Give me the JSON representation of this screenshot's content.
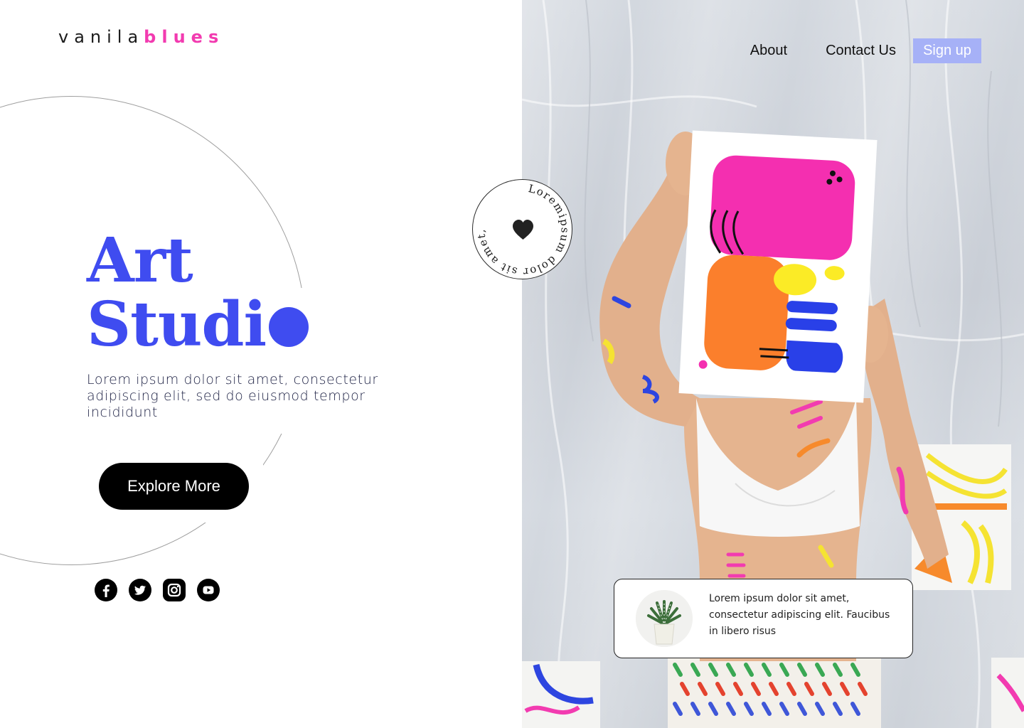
{
  "brand": {
    "logo_main": "vanila",
    "logo_accent": "blues",
    "accent_color": "#f23bb0"
  },
  "nav": {
    "about": "About",
    "contact": "Contact Us",
    "signup": "Sign up"
  },
  "hero": {
    "title_line1": "Art",
    "title_line2": "Studi",
    "description": "Lorem ipsum dolor sit amet, consectetur adipiscing elit, sed do eiusmod tempor incididunt",
    "cta": "Explore More",
    "title_color": "#3f4cf0"
  },
  "badge": {
    "circle_text": "Loremipsum dolor sit amet, cons",
    "icon": "heart-icon"
  },
  "socials": [
    {
      "name": "facebook-icon"
    },
    {
      "name": "twitter-icon"
    },
    {
      "name": "instagram-icon"
    },
    {
      "name": "youtube-icon"
    }
  ],
  "card": {
    "text": "Lorem ipsum dolor sit amet, consectetur adipiscing elit. Faucibus in libero risus",
    "thumb_icon": "plant-icon"
  },
  "colors": {
    "signup_bg": "#a6b1f7",
    "button_bg": "#000000"
  }
}
